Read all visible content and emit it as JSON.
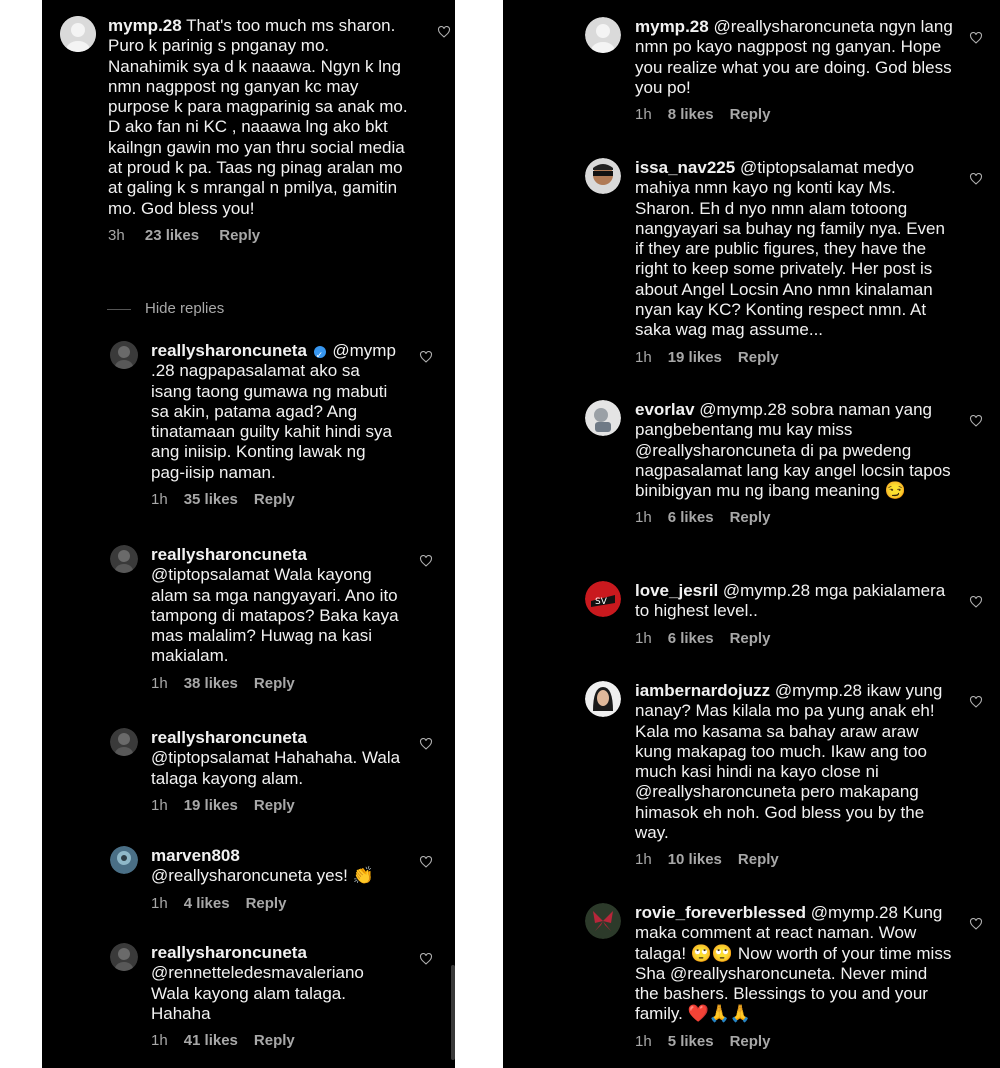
{
  "left": {
    "main_comment": {
      "username": "mymp.28",
      "text": "That's too much ms sharon. Puro k parinig s pnganay mo. Nanahimik sya d k naaawa. Ngyn k lng nmn nagppost ng ganyan kc may purpose k para magparinig sa anak mo. D ako fan ni KC , naaawa lng ako bkt kailngn gawin mo yan thru social media at proud k pa. Taas ng pinag aralan mo at galing k s mrangal n pmilya, gamitin mo. God bless you!",
      "time": "3h",
      "likes": "23 likes",
      "reply": "Reply"
    },
    "hide_replies": "Hide replies",
    "replies": [
      {
        "username": "reallysharoncuneta",
        "text": "@mymp .28 nagpapasalamat ako sa isang taong gumawa ng mabuti sa akin, patama agad? Ang tinatamaan guilty kahit hindi sya ang iniisip. Konting lawak ng pag-iisip naman.",
        "time": "1h",
        "likes": "35 likes",
        "reply": "Reply"
      },
      {
        "username": "reallysharoncuneta",
        "text": "@tiptopsalamat Wala kayong alam sa mga nangyayari. Ano ito tampong di matapos? Baka kaya mas malalim? Huwag na kasi makialam.",
        "time": "1h",
        "likes": "38 likes",
        "reply": "Reply"
      },
      {
        "username": "reallysharoncuneta",
        "text": "@tiptopsalamat Hahahaha. Wala talaga kayong alam.",
        "time": "1h",
        "likes": "19 likes",
        "reply": "Reply"
      },
      {
        "username": "marven808",
        "text": "@reallysharoncuneta yes! 👏",
        "time": "1h",
        "likes": "4 likes",
        "reply": "Reply"
      },
      {
        "username": "reallysharoncuneta",
        "text": "@rennetteledesmavaleriano Wala kayong alam talaga. Hahaha",
        "time": "1h",
        "likes": "41 likes",
        "reply": "Reply"
      }
    ]
  },
  "right": {
    "comments": [
      {
        "username": "mymp.28",
        "text": "@reallysharoncuneta ngyn lang nmn po kayo nagppost ng ganyan. Hope you realize what you are doing. God bless you po!",
        "time": "1h",
        "likes": "8 likes",
        "reply": "Reply"
      },
      {
        "username": "issa_nav225",
        "text": "@tiptopsalamat medyo mahiya nmn kayo ng konti kay Ms. Sharon. Eh d nyo nmn alam totoong nangyayari sa buhay ng family nya. Even if they are public figures, they have the right to keep some privately. Her post is about Angel Locsin Ano nmn kinalaman nyan kay KC? Konting respect nmn. At saka wag mag assume...",
        "time": "1h",
        "likes": "19 likes",
        "reply": "Reply"
      },
      {
        "username": "evorlav",
        "text": "@mymp.28 sobra naman yang pangbebentang mu kay miss @reallysharoncuneta di pa pwedeng nagpasalamat lang kay angel locsin tapos binibigyan mu ng ibang meaning 😏",
        "time": "1h",
        "likes": "6 likes",
        "reply": "Reply"
      },
      {
        "username": "love_jesril",
        "text": "@mymp.28 mga pakialamera to highest level..",
        "time": "1h",
        "likes": "6 likes",
        "reply": "Reply"
      },
      {
        "username": "iambernardojuzz",
        "text": "@mymp.28 ikaw yung nanay? Mas kilala mo pa yung anak eh! Kala mo kasama sa bahay araw araw kung makapag too much. Ikaw ang too much kasi hindi na kayo close ni @reallysharoncuneta  pero makapang himasok eh noh. God bless you by the way.",
        "time": "1h",
        "likes": "10 likes",
        "reply": "Reply"
      },
      {
        "username": "rovie_foreverblessed",
        "text": "@mymp.28 Kung maka comment at react naman. Wow talaga! 🙄🙄 Now worth of your time miss Sha @reallysharoncuneta. Never mind the bashers. Blessings to you and your family. ❤️🙏🙏",
        "time": "1h",
        "likes": "5 likes",
        "reply": "Reply"
      }
    ]
  },
  "colors": {
    "background": "#000000",
    "text": "#f2f2f2",
    "meta": "#a8a8a8",
    "verified": "#3897f0"
  }
}
